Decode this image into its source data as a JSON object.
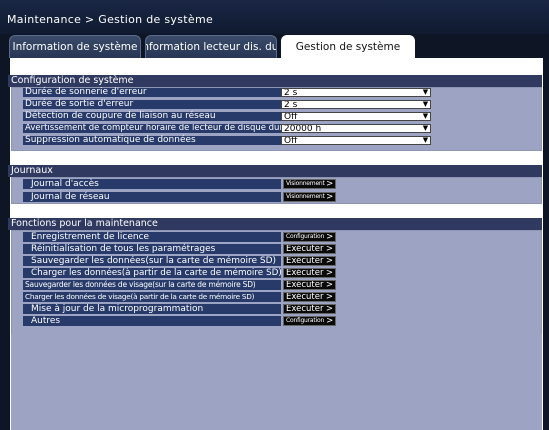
{
  "breadcrumb": "Maintenance > Gestion de système",
  "tabs": [
    {
      "label": "Information de système"
    },
    {
      "label": "Information lecteur dis. dur"
    },
    {
      "label": "Gestion de système"
    }
  ],
  "config": {
    "title": "Configuration de système",
    "rows": [
      {
        "label": "Durée de sonnerie d'erreur",
        "value": "2 s"
      },
      {
        "label": "Durée de sortie d'erreur",
        "value": "2 s"
      },
      {
        "label": "Détection de coupure de liaison au réseau",
        "value": "Off"
      },
      {
        "label": "Avertissement de compteur horaire de lecteur de disque dur",
        "value": "20000 h"
      },
      {
        "label": "Suppression automatique de données",
        "value": "Off"
      }
    ]
  },
  "logs": {
    "title": "Journaux",
    "rows": [
      {
        "label": "Journal d'accès",
        "button": "Visionnement"
      },
      {
        "label": "Journal de réseau",
        "button": "Visionnement"
      }
    ]
  },
  "maintenance": {
    "title": "Fonctions pour la maintenance",
    "rows": [
      {
        "label": "Enregistrement de licence",
        "button": "Configuration"
      },
      {
        "label": "Réinitialisation de tous les paramétrages",
        "button": "Exécuter"
      },
      {
        "label": "Sauvegarder les données(sur la carte de mémoire SD)",
        "button": "Exécuter"
      },
      {
        "label": "Charger les données(à partir de la carte de mémoire SD)",
        "button": "Exécuter"
      },
      {
        "label": "Sauvegarder les données de visage(sur la carte de mémoire SD)",
        "button": "Exécuter"
      },
      {
        "label": "Charger les données de visage(à partir de la carte de mémoire SD)",
        "button": "Exécuter"
      },
      {
        "label": "Mise à jour de la microprogrammation",
        "button": "Exécuter"
      },
      {
        "label": "Autres",
        "button": "Configuration"
      }
    ]
  },
  "icons": {
    "dropdown": "chevron-down-icon",
    "button_arrow": "chevron-right-icon"
  }
}
